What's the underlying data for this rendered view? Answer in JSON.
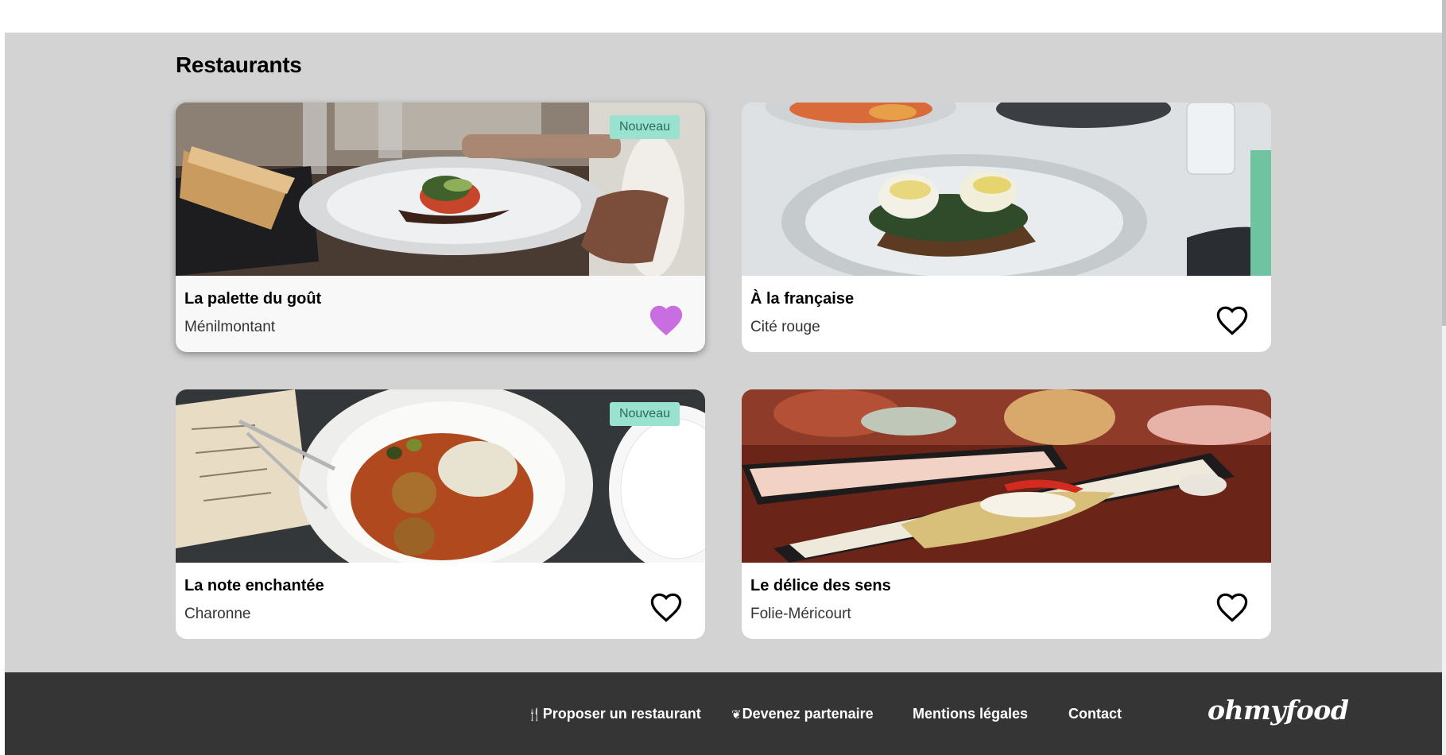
{
  "section": {
    "title": "Restaurants"
  },
  "restaurants": [
    {
      "name": "La palette du goût",
      "location": "Ménilmontant",
      "badge": "Nouveau",
      "favorite": true
    },
    {
      "name": "À la française",
      "location": "Cité rouge",
      "favorite": false
    },
    {
      "name": "La note enchantée",
      "location": "Charonne",
      "badge": "Nouveau",
      "favorite": false
    },
    {
      "name": "Le délice des sens",
      "location": "Folie-Méricourt",
      "favorite": false
    }
  ],
  "footer": {
    "links": [
      {
        "label": "Proposer un restaurant",
        "icon": "utensils-icon"
      },
      {
        "label": "Devenez partenaire",
        "icon": "leaf-icon"
      },
      {
        "label": "Mentions légales"
      },
      {
        "label": "Contact"
      }
    ],
    "logo": "ohmyfood"
  },
  "colors": {
    "background": "#d3d3d3",
    "badge": "#99e2d0",
    "favorite_heart": "#c86ee0",
    "footer": "#353535"
  }
}
